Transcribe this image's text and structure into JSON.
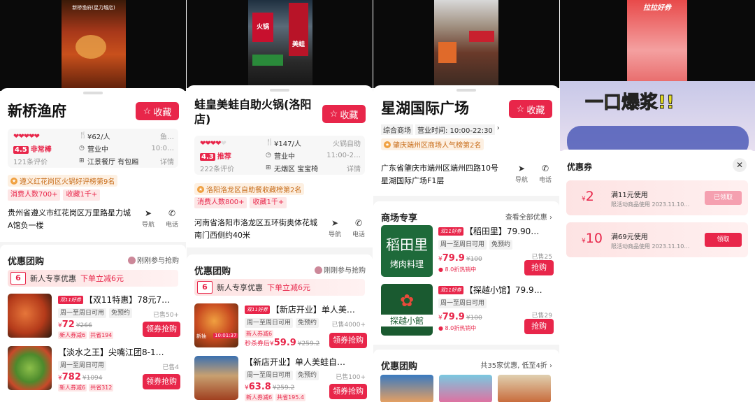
{
  "colors": {
    "accent": "#e8264a",
    "rank": "#c86d1a",
    "rank_bg": "#fdf0e2"
  },
  "panel1": {
    "video_caption": "新桥渔府(星力城店)",
    "title": "新桥渔府",
    "fav_label": "收藏",
    "rating_hearts": "❤❤❤❤❤",
    "score": "4.5",
    "score_text": "非常棒",
    "review_count": "121条评价",
    "price": "¥62/人",
    "price_side": "鱼…",
    "status": "营业中",
    "status_side": "10:0…",
    "feature": "江景餐厅 有包厢",
    "feature_side": "详情",
    "rank": "遵义红花岗区火锅好评榜第9名",
    "tags": [
      "消费人数700+",
      "收藏1千+"
    ],
    "address": "贵州省遵义市红花岗区万里路星力城A馆负一楼",
    "nav_label": "导航",
    "phone_label": "电话",
    "section_title": "优惠团购",
    "section_right": "刚刚参与抢购",
    "promo_amount": "6",
    "promo_label": "新人专享优惠",
    "promo_highlight": "下单立减6元",
    "deals": [
      {
        "badge": "双11好券",
        "title": "【双11特惠】78元7…",
        "tags": [
          "周一至周日可用",
          "免预约"
        ],
        "sold": "已售50+",
        "price": "72",
        "orig": "¥266",
        "small": [
          "新人券减6",
          "共省194"
        ],
        "button": "领券抢购"
      },
      {
        "badge": "",
        "title": "【淡水之王】尖嘴江团8-1…",
        "tags": [
          "周一至周日可用"
        ],
        "sold": "已售4",
        "price": "782",
        "orig": "¥1094",
        "small": [
          "新人券减6",
          "共省312"
        ],
        "button": "领券抢购"
      }
    ]
  },
  "panel2": {
    "video_sign_a": "火锅",
    "video_sign_b": "美蛙",
    "title": "蛙皇美蛙自助火锅(洛阳店)",
    "fav_label": "收藏",
    "rating_hearts": "❤❤❤❤",
    "score": "4.3",
    "score_text": "推荐",
    "review_count": "222条评价",
    "price": "¥147/人",
    "price_side": "火锅自助",
    "status": "营业中",
    "status_side": "11:00-2…",
    "feature": "无烟区 宝宝椅",
    "feature_side": "详情",
    "rank": "洛阳洛龙区自助餐收藏榜第2名",
    "tags": [
      "消费人数800+",
      "收藏1千+"
    ],
    "address": "河南省洛阳市洛龙区五环街奥体花城南门西侧约40米",
    "nav_label": "导航",
    "phone_label": "电话",
    "section_title": "优惠团购",
    "section_right": "刚刚参与抢购",
    "promo_amount": "6",
    "promo_label": "新人专享优惠",
    "promo_highlight": "下单立减6元",
    "deal1_overlay": "新抽",
    "deal1_timer": "10:01:37",
    "deals": [
      {
        "badge": "双11好券",
        "title": "【新店开业】单人美…",
        "tags": [
          "周一至周日可用",
          "免预约"
        ],
        "sold": "已售4000+",
        "price": "59.9",
        "pre": "秒杀券后",
        "orig": "¥259.2",
        "small": [
          "新人券减6"
        ],
        "button": "领券抢购"
      },
      {
        "badge": "",
        "title": "【新店开业】单人美蛙自…",
        "tags": [
          "周一至周日可用",
          "免预约"
        ],
        "sold": "已售100+",
        "price": "63.8",
        "pre": "",
        "orig": "¥259.2",
        "small": [
          "新人券减6",
          "共省195.4"
        ],
        "button": "领券抢购"
      }
    ]
  },
  "panel3": {
    "title": "星湖国际广场",
    "fav_label": "收藏",
    "category": "综合商场",
    "hours": "营业时间: 10:00-22:30",
    "rank": "肇庆端州区商场人气榜第2名",
    "address": "广东省肇庆市端州区端州四路10号星湖国际广场F1层",
    "nav_label": "导航",
    "phone_label": "电话",
    "mall_title": "商场专享",
    "mall_right": "查看全部优惠",
    "shops": [
      {
        "badge": "双11好券",
        "name": "【稻田里】79.90…",
        "logo": "稻田里",
        "logo2": "烤肉料理",
        "tags": [
          "周一至周日可用",
          "免预约"
        ],
        "sold": "已售25",
        "price": "79.9",
        "orig": "¥100",
        "hot": "8.0折热销中",
        "button": "抢购"
      },
      {
        "badge": "双11好券",
        "name": "【探越小馆】79.9…",
        "logo": "探越小館",
        "logo2": "",
        "tags": [
          "周一至周日可用"
        ],
        "sold": "已售29",
        "price": "79.9",
        "orig": "¥100",
        "hot": "8.0折热销中",
        "button": "抢购"
      }
    ],
    "group_title": "优惠团购",
    "group_right": "共35家优惠, 低至4折"
  },
  "panel4": {
    "banner_top": "拉拉好券",
    "banner_big": "一口爆浆!!",
    "coupon_title": "优惠券",
    "coupons": [
      {
        "amount": "2",
        "condition": "满11元使用",
        "sub": "限活动商品使用 2023.11.10…",
        "button": "已领取",
        "claimed": true
      },
      {
        "amount": "10",
        "condition": "满69元使用",
        "sub": "限活动商品使用 2023.11.10…",
        "button": "领取",
        "claimed": false
      }
    ]
  }
}
